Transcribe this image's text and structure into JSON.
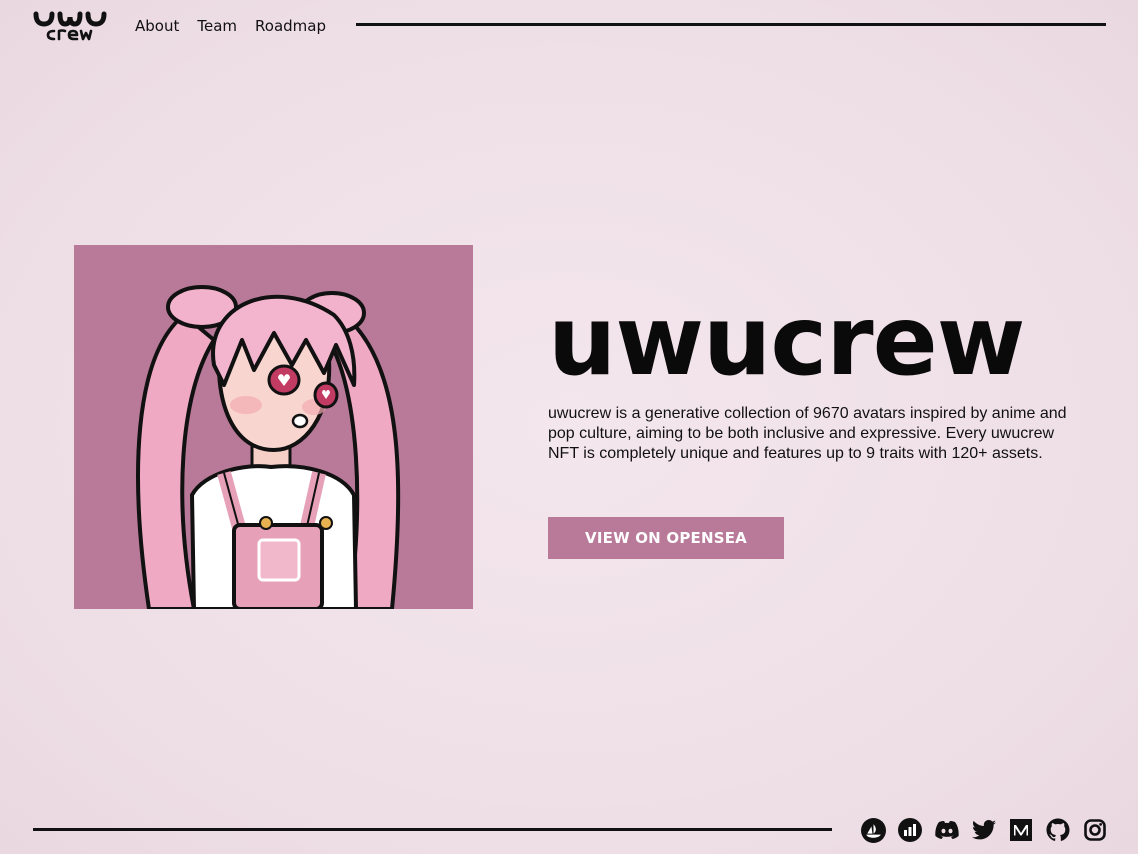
{
  "header": {
    "logo_alt": "uwu crew",
    "nav": [
      {
        "label": "About"
      },
      {
        "label": "Team"
      },
      {
        "label": "Roadmap"
      }
    ]
  },
  "hero": {
    "title": "uwucrew",
    "description": "uwucrew is a generative collection of 9670 avatars inspired by anime and pop culture, aiming to be both inclusive and expressive. Every uwucrew NFT is completely unique and features up to 9 traits with 120+ assets.",
    "cta_label": "VIEW ON OPENSEA"
  },
  "colors": {
    "accent": "#b87a98",
    "background": "#efe0e7",
    "ink": "#111111"
  },
  "socials": [
    {
      "icon": "opensea-icon"
    },
    {
      "icon": "stats-icon"
    },
    {
      "icon": "discord-icon"
    },
    {
      "icon": "twitter-icon"
    },
    {
      "icon": "medium-icon"
    },
    {
      "icon": "github-icon"
    },
    {
      "icon": "instagram-icon"
    }
  ]
}
